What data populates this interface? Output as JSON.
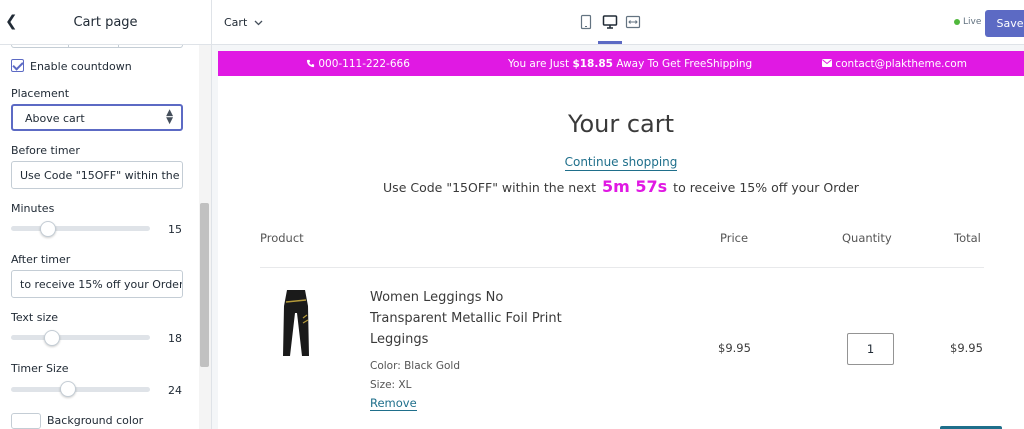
{
  "sidebar": {
    "title": "Cart page",
    "enable_countdown_label": "Enable countdown",
    "placement_label": "Placement",
    "placement_value": "Above cart",
    "before_timer_label": "Before timer",
    "before_timer_value": "Use Code \"15OFF\" within the ne",
    "minutes_label": "Minutes",
    "minutes_value": "15",
    "minutes_level": 0.26,
    "after_timer_label": "After timer",
    "after_timer_value": "to receive 15% off your Order",
    "text_size_label": "Text size",
    "text_size_value": "18",
    "text_size_level": 0.29,
    "timer_size_label": "Timer Size",
    "timer_size_value": "24",
    "timer_size_level": 0.41,
    "background_color_label": "Background color"
  },
  "topbar": {
    "page_select": "Cart",
    "live_label": "Live",
    "save_label": "Save"
  },
  "preview": {
    "promo": {
      "phone": "000-111-222-666",
      "shipping_prefix": "You are Just",
      "shipping_amount": "$18.85",
      "shipping_suffix": "Away To Get FreeShipping",
      "email": "contact@plaktheme.com"
    },
    "title": "Your cart",
    "continue_label": "Continue shopping",
    "countdown_before": "Use Code \"15OFF\" within the next",
    "countdown_timer": "5m 57s",
    "countdown_after": "to receive 15% off your Order",
    "headers": {
      "product": "Product",
      "price": "Price",
      "quantity": "Quantity",
      "total": "Total"
    },
    "item": {
      "name": "Women Leggings No Transparent Metallic Foil Print Leggings",
      "color": "Color: Black Gold",
      "size": "Size: XL",
      "remove_label": "Remove",
      "price": "$9.95",
      "quantity": "1",
      "total": "$9.95"
    }
  },
  "colors": {
    "accent": "#5c6ac4",
    "promo_bg": "#e019e3",
    "link": "#1f6f8b",
    "live": "#50b83c"
  }
}
